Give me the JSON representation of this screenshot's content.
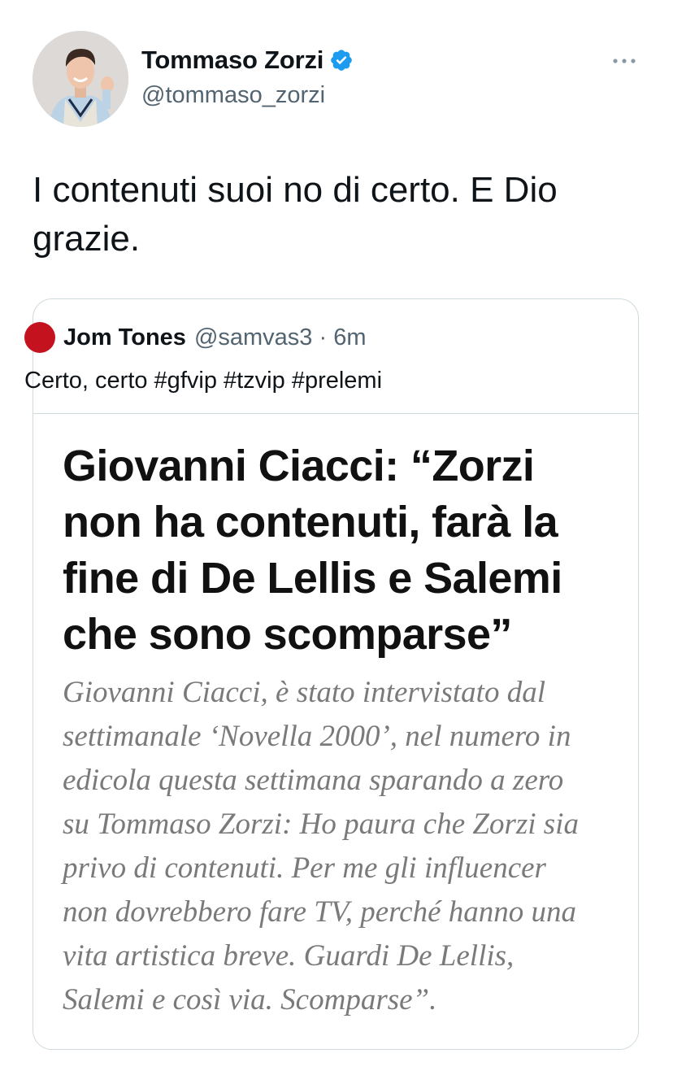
{
  "tweet": {
    "author_name": "Tommaso Zorzi",
    "author_handle": "@tommaso_zorzi",
    "text": "I contenuti suoi no di certo. E Dio\ngrazie."
  },
  "quoted_tweet": {
    "author_name": "Jom Tones",
    "meta": "@samvas3 · 6m",
    "text": "Certo, certo #gfvip #tzvip #prelemi",
    "image": {
      "headline": "Giovanni Ciacci: “Zorzi\nnon ha contenuti, farà la\nfine di De Lellis e Salemi\nche sono scomparse”",
      "body": "Giovanni Ciacci, è stato intervistato dal\nsettimanale ‘Novella 2000’, nel numero in\nedicola questa settimana sparando a zero\nsu Tommaso Zorzi: Ho paura che Zorzi sia\nprivo di contenuti. Per me gli influencer\nnon dovrebbero fare TV, perché hanno una\nvita artistica breve. Guardi De Lellis,\nSalemi e così via. Scomparse”."
    }
  },
  "icons": {
    "verified": "verified-badge-icon",
    "more": "more-options-icon"
  },
  "colors": {
    "verified_blue": "#1d9bf0",
    "quoted_avatar_red": "#c4131f",
    "secondary_text": "#536471"
  }
}
